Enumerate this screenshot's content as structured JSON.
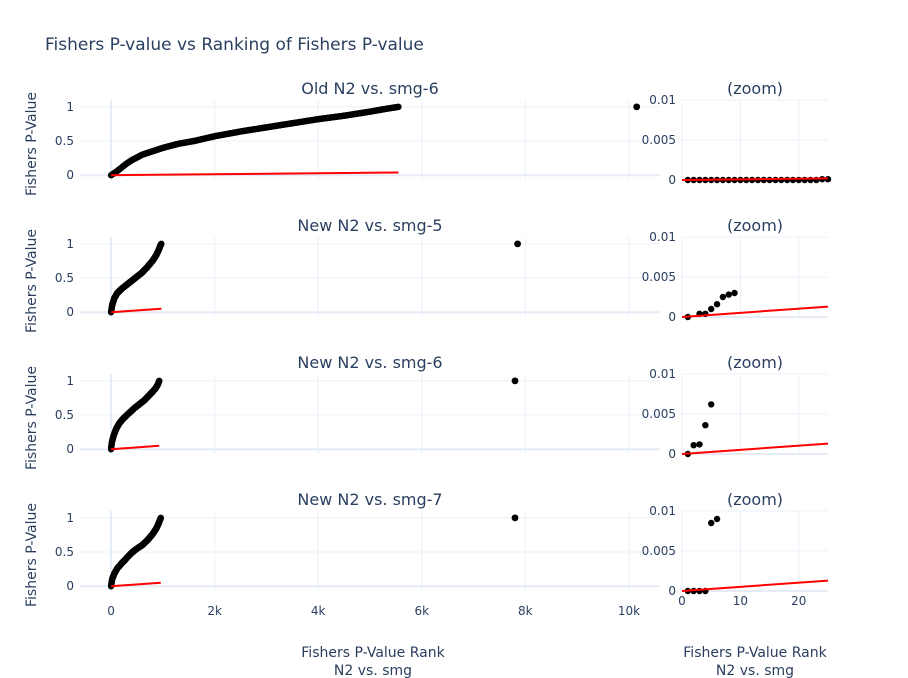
{
  "figure": {
    "title": "Fishers P-value vs Ranking of Fishers P-value"
  },
  "chart_data": [
    {
      "type": "scatter",
      "title": "Old N2 vs. smg-6",
      "ylabel": "Fishers P-Value",
      "xlim": [
        -600,
        10600
      ],
      "ylim": [
        -0.07,
        1.1
      ],
      "yticks": [
        0,
        0.5,
        1
      ],
      "grid": true,
      "series": [
        {
          "name": "",
          "kind": "markers",
          "color": "#000000",
          "curve": [
            [
              0,
              0
            ],
            [
              100,
              0.05
            ],
            [
              200,
              0.11
            ],
            [
              300,
              0.17
            ],
            [
              400,
              0.22
            ],
            [
              600,
              0.3
            ],
            [
              800,
              0.35
            ],
            [
              1000,
              0.4
            ],
            [
              1300,
              0.46
            ],
            [
              1600,
              0.5
            ],
            [
              2000,
              0.57
            ],
            [
              2500,
              0.64
            ],
            [
              3000,
              0.7
            ],
            [
              3500,
              0.76
            ],
            [
              4000,
              0.82
            ],
            [
              4500,
              0.87
            ],
            [
              5000,
              0.93
            ],
            [
              5300,
              0.97
            ],
            [
              5550,
              1.0
            ]
          ],
          "outliers": [
            [
              10150,
              1.0
            ]
          ]
        },
        {
          "name": "",
          "kind": "line",
          "color": "#ff0000",
          "x": [
            0,
            5550
          ],
          "y": [
            0,
            0.04
          ]
        }
      ]
    },
    {
      "type": "scatter",
      "title": "(zoom)",
      "xlim": [
        0,
        25
      ],
      "ylim": [
        0,
        0.01
      ],
      "yticks": [
        0,
        0.005,
        0.01
      ],
      "grid": true,
      "series": [
        {
          "name": "",
          "kind": "markers",
          "color": "#000000",
          "x": [
            1,
            2,
            3,
            4,
            5,
            6,
            7,
            8,
            9,
            10,
            11,
            12,
            13,
            14,
            15,
            16,
            17,
            18,
            19,
            20,
            21,
            22,
            23,
            24,
            25
          ],
          "y": [
            0,
            0,
            0,
            0,
            0,
            0,
            0,
            0,
            0,
            0,
            0,
            0,
            0,
            0,
            0,
            0,
            0,
            0,
            0,
            0,
            0,
            0,
            0,
            0.0001,
            0.0001
          ]
        },
        {
          "name": "",
          "kind": "line",
          "color": "#ff0000",
          "x": [
            0,
            25
          ],
          "y": [
            0,
            0.0002
          ]
        }
      ]
    },
    {
      "type": "scatter",
      "title": "New N2 vs. smg-5",
      "ylabel": "Fishers P-Value",
      "xlim": [
        -600,
        10600
      ],
      "ylim": [
        -0.07,
        1.1
      ],
      "yticks": [
        0,
        0.5,
        1
      ],
      "grid": true,
      "series": [
        {
          "name": "",
          "kind": "markers",
          "color": "#000000",
          "curve": [
            [
              0,
              0
            ],
            [
              20,
              0.1
            ],
            [
              60,
              0.2
            ],
            [
              120,
              0.28
            ],
            [
              200,
              0.34
            ],
            [
              300,
              0.4
            ],
            [
              400,
              0.46
            ],
            [
              500,
              0.52
            ],
            [
              600,
              0.58
            ],
            [
              700,
              0.66
            ],
            [
              800,
              0.75
            ],
            [
              870,
              0.83
            ],
            [
              920,
              0.91
            ],
            [
              950,
              0.97
            ],
            [
              970,
              1.0
            ]
          ],
          "outliers": [
            [
              7850,
              1.0
            ]
          ]
        },
        {
          "name": "",
          "kind": "line",
          "color": "#ff0000",
          "x": [
            0,
            970
          ],
          "y": [
            0,
            0.05
          ]
        }
      ]
    },
    {
      "type": "scatter",
      "title": "(zoom)",
      "xlim": [
        0,
        25
      ],
      "ylim": [
        0,
        0.01
      ],
      "yticks": [
        0,
        0.005,
        0.01
      ],
      "grid": true,
      "series": [
        {
          "name": "",
          "kind": "markers",
          "color": "#000000",
          "x": [
            1,
            3,
            4,
            5,
            6,
            7,
            8,
            9
          ],
          "y": [
            0,
            0.0004,
            0.0004,
            0.001,
            0.0016,
            0.0025,
            0.0028,
            0.003
          ]
        },
        {
          "name": "",
          "kind": "line",
          "color": "#ff0000",
          "x": [
            0,
            25
          ],
          "y": [
            0,
            0.0013
          ]
        }
      ]
    },
    {
      "type": "scatter",
      "title": "New N2 vs. smg-6",
      "ylabel": "Fishers P-Value",
      "xlim": [
        -600,
        10600
      ],
      "ylim": [
        -0.07,
        1.1
      ],
      "yticks": [
        0,
        0.5,
        1
      ],
      "grid": true,
      "series": [
        {
          "name": "",
          "kind": "markers",
          "color": "#000000",
          "curve": [
            [
              0,
              0
            ],
            [
              15,
              0.1
            ],
            [
              50,
              0.2
            ],
            [
              100,
              0.3
            ],
            [
              160,
              0.38
            ],
            [
              250,
              0.46
            ],
            [
              350,
              0.53
            ],
            [
              450,
              0.6
            ],
            [
              550,
              0.66
            ],
            [
              650,
              0.72
            ],
            [
              750,
              0.8
            ],
            [
              850,
              0.88
            ],
            [
              900,
              0.94
            ],
            [
              930,
              1.0
            ]
          ],
          "outliers": [
            [
              7800,
              1.0
            ]
          ]
        },
        {
          "name": "",
          "kind": "line",
          "color": "#ff0000",
          "x": [
            0,
            930
          ],
          "y": [
            0,
            0.05
          ]
        }
      ]
    },
    {
      "type": "scatter",
      "title": "(zoom)",
      "xlim": [
        0,
        25
      ],
      "ylim": [
        0,
        0.01
      ],
      "yticks": [
        0,
        0.005,
        0.01
      ],
      "grid": true,
      "series": [
        {
          "name": "",
          "kind": "markers",
          "color": "#000000",
          "x": [
            1,
            2,
            3,
            4,
            5
          ],
          "y": [
            0,
            0.0011,
            0.0012,
            0.0036,
            0.0062
          ]
        },
        {
          "name": "",
          "kind": "line",
          "color": "#ff0000",
          "x": [
            0,
            25
          ],
          "y": [
            0,
            0.0013
          ]
        }
      ]
    },
    {
      "type": "scatter",
      "title": "New N2 vs. smg-7",
      "ylabel": "Fishers P-Value",
      "xlim": [
        -600,
        10600
      ],
      "ylim": [
        -0.07,
        1.1
      ],
      "yticks": [
        0,
        0.5,
        1
      ],
      "grid": true,
      "series": [
        {
          "name": "",
          "kind": "markers",
          "color": "#000000",
          "curve": [
            [
              0,
              0
            ],
            [
              20,
              0.1
            ],
            [
              60,
              0.18
            ],
            [
              120,
              0.26
            ],
            [
              200,
              0.33
            ],
            [
              300,
              0.41
            ],
            [
              400,
              0.49
            ],
            [
              500,
              0.55
            ],
            [
              600,
              0.6
            ],
            [
              700,
              0.67
            ],
            [
              800,
              0.76
            ],
            [
              870,
              0.84
            ],
            [
              920,
              0.92
            ],
            [
              950,
              0.98
            ],
            [
              960,
              1.0
            ]
          ],
          "outliers": [
            [
              7800,
              1.0
            ]
          ]
        },
        {
          "name": "",
          "kind": "line",
          "color": "#ff0000",
          "x": [
            0,
            960
          ],
          "y": [
            0,
            0.05
          ]
        }
      ]
    },
    {
      "type": "scatter",
      "title": "(zoom)",
      "xlabel": "Fishers P-Value Rank\nN2 vs. smg",
      "xlim": [
        0,
        25
      ],
      "ylim": [
        0,
        0.01
      ],
      "yticks": [
        0,
        0.005,
        0.01
      ],
      "xticks": [
        0,
        10,
        20
      ],
      "grid": true,
      "series": [
        {
          "name": "",
          "kind": "markers",
          "color": "#000000",
          "x": [
            1,
            2,
            3,
            4,
            5,
            6
          ],
          "y": [
            0,
            0,
            0,
            0,
            0.0085,
            0.009
          ]
        },
        {
          "name": "",
          "kind": "line",
          "color": "#ff0000",
          "x": [
            0,
            25
          ],
          "y": [
            0,
            0.0013
          ]
        }
      ]
    }
  ],
  "main_xaxis": {
    "label": "Fishers P-Value Rank\nN2 vs. smg",
    "ticks": [
      0,
      2000,
      4000,
      6000,
      8000,
      10000
    ],
    "tick_labels": [
      "0",
      "2k",
      "4k",
      "6k",
      "8k",
      "10k"
    ]
  },
  "zoom_xaxis": {
    "tick_labels": [
      "0",
      "10",
      "20"
    ]
  },
  "colors": {
    "marker": "#000000",
    "reference_line": "#ff0000",
    "grid": "#ebf0f8",
    "zeroline": "#e5ecf6",
    "text": "#2a3f5f"
  }
}
